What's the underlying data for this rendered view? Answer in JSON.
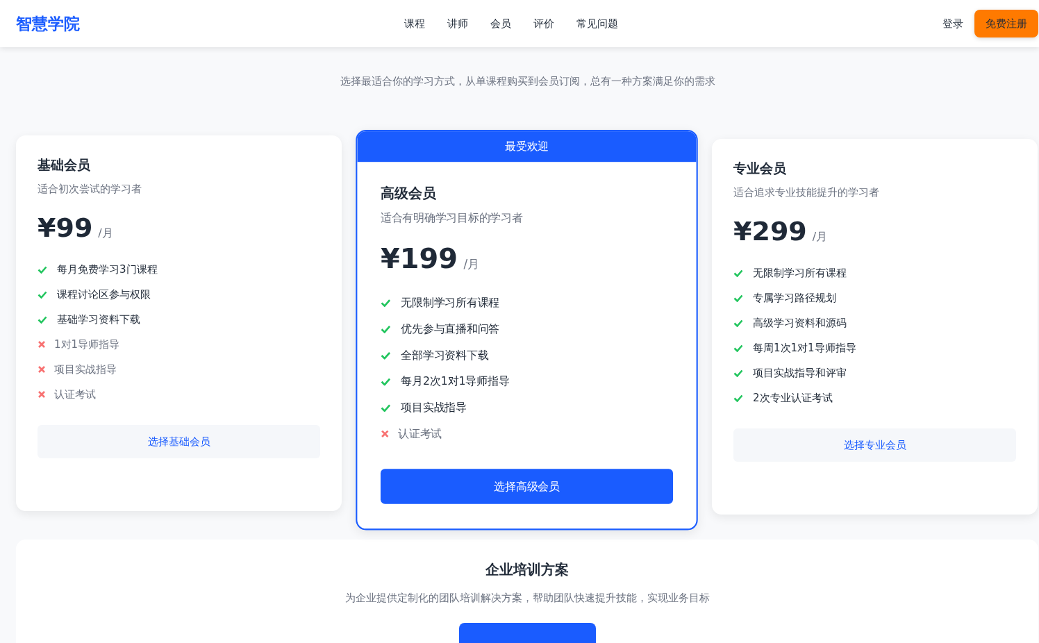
{
  "header": {
    "logo": "智慧学院",
    "nav": [
      {
        "label": "课程"
      },
      {
        "label": "讲师"
      },
      {
        "label": "会员"
      },
      {
        "label": "评价"
      },
      {
        "label": "常见问题"
      }
    ],
    "login": "登录",
    "signup": "免费注册"
  },
  "hero": {
    "subtitle": "选择最适合你的学习方式，从单课程购买到会员订阅，总有一种方案满足你的需求"
  },
  "plans": [
    {
      "name": "基础会员",
      "desc": "适合初次尝试的学习者",
      "price": "¥99",
      "period": "/月",
      "featured": false,
      "features": [
        {
          "text": "每月免费学习3门课程",
          "included": true
        },
        {
          "text": "课程讨论区参与权限",
          "included": true
        },
        {
          "text": "基础学习资料下载",
          "included": true
        },
        {
          "text": "1对1导师指导",
          "included": false
        },
        {
          "text": "项目实战指导",
          "included": false
        },
        {
          "text": "认证考试",
          "included": false
        }
      ],
      "button": "选择基础会员"
    },
    {
      "name": "高级会员",
      "desc": "适合有明确学习目标的学习者",
      "price": "¥199",
      "period": "/月",
      "featured": true,
      "badge": "最受欢迎",
      "features": [
        {
          "text": "无限制学习所有课程",
          "included": true
        },
        {
          "text": "优先参与直播和问答",
          "included": true
        },
        {
          "text": "全部学习资料下载",
          "included": true
        },
        {
          "text": "每月2次1对1导师指导",
          "included": true
        },
        {
          "text": "项目实战指导",
          "included": true
        },
        {
          "text": "认证考试",
          "included": false
        }
      ],
      "button": "选择高级会员"
    },
    {
      "name": "专业会员",
      "desc": "适合追求专业技能提升的学习者",
      "price": "¥299",
      "period": "/月",
      "featured": false,
      "features": [
        {
          "text": "无限制学习所有课程",
          "included": true
        },
        {
          "text": "专属学习路径规划",
          "included": true
        },
        {
          "text": "高级学习资料和源码",
          "included": true
        },
        {
          "text": "每周1次1对1导师指导",
          "included": true
        },
        {
          "text": "项目实战指导和评审",
          "included": true
        },
        {
          "text": "2次专业认证考试",
          "included": true
        }
      ],
      "button": "选择专业会员"
    }
  ],
  "enterprise": {
    "title": "企业培训方案",
    "desc": "为企业提供定制化的团队培训解决方案，帮助团队快速提升技能，实现业务目标"
  }
}
